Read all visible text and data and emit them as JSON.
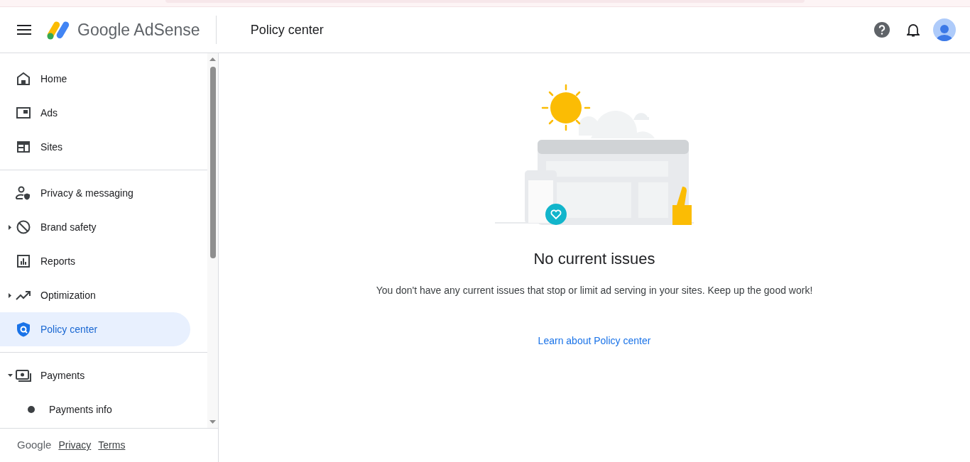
{
  "header": {
    "product": "Google AdSense",
    "page_title": "Policy center"
  },
  "sidebar": {
    "sections": [
      [
        {
          "label": "Home",
          "selected": false
        },
        {
          "label": "Ads",
          "selected": false
        },
        {
          "label": "Sites",
          "selected": false
        }
      ],
      [
        {
          "label": "Privacy & messaging",
          "selected": false
        },
        {
          "label": "Brand safety",
          "selected": false,
          "expanded": false
        },
        {
          "label": "Reports",
          "selected": false
        },
        {
          "label": "Optimization",
          "selected": false,
          "expanded": false
        },
        {
          "label": "Policy center",
          "selected": true
        }
      ],
      [
        {
          "label": "Payments",
          "selected": false,
          "expanded": true,
          "children": [
            {
              "label": "Payments info",
              "selected": false
            }
          ]
        }
      ]
    ],
    "footer": {
      "brand": "Google",
      "links": [
        "Privacy",
        "Terms"
      ]
    }
  },
  "main": {
    "heading": "No current issues",
    "message": "You don't have any current issues that stop or limit ad serving in your sites. Keep up the good work!",
    "link": "Learn about Policy center"
  }
}
